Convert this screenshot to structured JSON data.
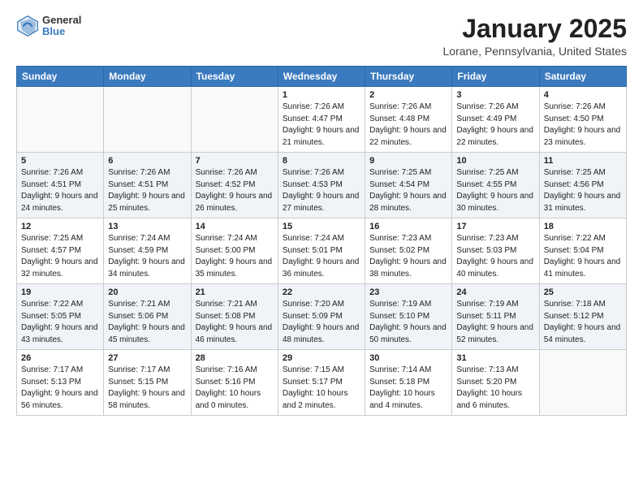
{
  "header": {
    "logo_general": "General",
    "logo_blue": "Blue",
    "month": "January 2025",
    "location": "Lorane, Pennsylvania, United States"
  },
  "weekdays": [
    "Sunday",
    "Monday",
    "Tuesday",
    "Wednesday",
    "Thursday",
    "Friday",
    "Saturday"
  ],
  "weeks": [
    [
      {
        "day": "",
        "sunrise": "",
        "sunset": "",
        "daylight": ""
      },
      {
        "day": "",
        "sunrise": "",
        "sunset": "",
        "daylight": ""
      },
      {
        "day": "",
        "sunrise": "",
        "sunset": "",
        "daylight": ""
      },
      {
        "day": "1",
        "sunrise": "Sunrise: 7:26 AM",
        "sunset": "Sunset: 4:47 PM",
        "daylight": "Daylight: 9 hours and 21 minutes."
      },
      {
        "day": "2",
        "sunrise": "Sunrise: 7:26 AM",
        "sunset": "Sunset: 4:48 PM",
        "daylight": "Daylight: 9 hours and 22 minutes."
      },
      {
        "day": "3",
        "sunrise": "Sunrise: 7:26 AM",
        "sunset": "Sunset: 4:49 PM",
        "daylight": "Daylight: 9 hours and 22 minutes."
      },
      {
        "day": "4",
        "sunrise": "Sunrise: 7:26 AM",
        "sunset": "Sunset: 4:50 PM",
        "daylight": "Daylight: 9 hours and 23 minutes."
      }
    ],
    [
      {
        "day": "5",
        "sunrise": "Sunrise: 7:26 AM",
        "sunset": "Sunset: 4:51 PM",
        "daylight": "Daylight: 9 hours and 24 minutes."
      },
      {
        "day": "6",
        "sunrise": "Sunrise: 7:26 AM",
        "sunset": "Sunset: 4:51 PM",
        "daylight": "Daylight: 9 hours and 25 minutes."
      },
      {
        "day": "7",
        "sunrise": "Sunrise: 7:26 AM",
        "sunset": "Sunset: 4:52 PM",
        "daylight": "Daylight: 9 hours and 26 minutes."
      },
      {
        "day": "8",
        "sunrise": "Sunrise: 7:26 AM",
        "sunset": "Sunset: 4:53 PM",
        "daylight": "Daylight: 9 hours and 27 minutes."
      },
      {
        "day": "9",
        "sunrise": "Sunrise: 7:25 AM",
        "sunset": "Sunset: 4:54 PM",
        "daylight": "Daylight: 9 hours and 28 minutes."
      },
      {
        "day": "10",
        "sunrise": "Sunrise: 7:25 AM",
        "sunset": "Sunset: 4:55 PM",
        "daylight": "Daylight: 9 hours and 30 minutes."
      },
      {
        "day": "11",
        "sunrise": "Sunrise: 7:25 AM",
        "sunset": "Sunset: 4:56 PM",
        "daylight": "Daylight: 9 hours and 31 minutes."
      }
    ],
    [
      {
        "day": "12",
        "sunrise": "Sunrise: 7:25 AM",
        "sunset": "Sunset: 4:57 PM",
        "daylight": "Daylight: 9 hours and 32 minutes."
      },
      {
        "day": "13",
        "sunrise": "Sunrise: 7:24 AM",
        "sunset": "Sunset: 4:59 PM",
        "daylight": "Daylight: 9 hours and 34 minutes."
      },
      {
        "day": "14",
        "sunrise": "Sunrise: 7:24 AM",
        "sunset": "Sunset: 5:00 PM",
        "daylight": "Daylight: 9 hours and 35 minutes."
      },
      {
        "day": "15",
        "sunrise": "Sunrise: 7:24 AM",
        "sunset": "Sunset: 5:01 PM",
        "daylight": "Daylight: 9 hours and 36 minutes."
      },
      {
        "day": "16",
        "sunrise": "Sunrise: 7:23 AM",
        "sunset": "Sunset: 5:02 PM",
        "daylight": "Daylight: 9 hours and 38 minutes."
      },
      {
        "day": "17",
        "sunrise": "Sunrise: 7:23 AM",
        "sunset": "Sunset: 5:03 PM",
        "daylight": "Daylight: 9 hours and 40 minutes."
      },
      {
        "day": "18",
        "sunrise": "Sunrise: 7:22 AM",
        "sunset": "Sunset: 5:04 PM",
        "daylight": "Daylight: 9 hours and 41 minutes."
      }
    ],
    [
      {
        "day": "19",
        "sunrise": "Sunrise: 7:22 AM",
        "sunset": "Sunset: 5:05 PM",
        "daylight": "Daylight: 9 hours and 43 minutes."
      },
      {
        "day": "20",
        "sunrise": "Sunrise: 7:21 AM",
        "sunset": "Sunset: 5:06 PM",
        "daylight": "Daylight: 9 hours and 45 minutes."
      },
      {
        "day": "21",
        "sunrise": "Sunrise: 7:21 AM",
        "sunset": "Sunset: 5:08 PM",
        "daylight": "Daylight: 9 hours and 46 minutes."
      },
      {
        "day": "22",
        "sunrise": "Sunrise: 7:20 AM",
        "sunset": "Sunset: 5:09 PM",
        "daylight": "Daylight: 9 hours and 48 minutes."
      },
      {
        "day": "23",
        "sunrise": "Sunrise: 7:19 AM",
        "sunset": "Sunset: 5:10 PM",
        "daylight": "Daylight: 9 hours and 50 minutes."
      },
      {
        "day": "24",
        "sunrise": "Sunrise: 7:19 AM",
        "sunset": "Sunset: 5:11 PM",
        "daylight": "Daylight: 9 hours and 52 minutes."
      },
      {
        "day": "25",
        "sunrise": "Sunrise: 7:18 AM",
        "sunset": "Sunset: 5:12 PM",
        "daylight": "Daylight: 9 hours and 54 minutes."
      }
    ],
    [
      {
        "day": "26",
        "sunrise": "Sunrise: 7:17 AM",
        "sunset": "Sunset: 5:13 PM",
        "daylight": "Daylight: 9 hours and 56 minutes."
      },
      {
        "day": "27",
        "sunrise": "Sunrise: 7:17 AM",
        "sunset": "Sunset: 5:15 PM",
        "daylight": "Daylight: 9 hours and 58 minutes."
      },
      {
        "day": "28",
        "sunrise": "Sunrise: 7:16 AM",
        "sunset": "Sunset: 5:16 PM",
        "daylight": "Daylight: 10 hours and 0 minutes."
      },
      {
        "day": "29",
        "sunrise": "Sunrise: 7:15 AM",
        "sunset": "Sunset: 5:17 PM",
        "daylight": "Daylight: 10 hours and 2 minutes."
      },
      {
        "day": "30",
        "sunrise": "Sunrise: 7:14 AM",
        "sunset": "Sunset: 5:18 PM",
        "daylight": "Daylight: 10 hours and 4 minutes."
      },
      {
        "day": "31",
        "sunrise": "Sunrise: 7:13 AM",
        "sunset": "Sunset: 5:20 PM",
        "daylight": "Daylight: 10 hours and 6 minutes."
      },
      {
        "day": "",
        "sunrise": "",
        "sunset": "",
        "daylight": ""
      }
    ]
  ]
}
